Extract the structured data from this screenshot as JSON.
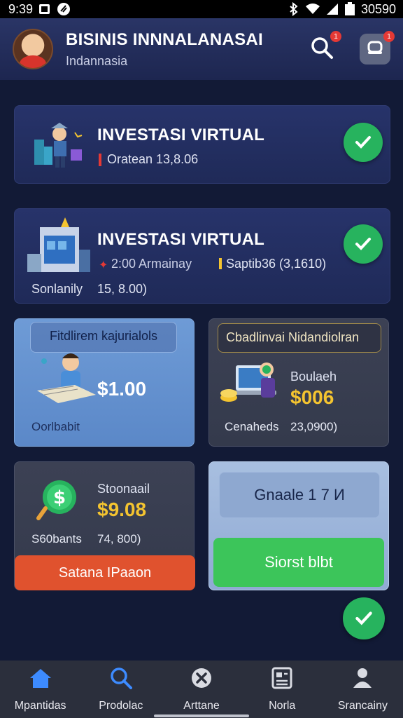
{
  "status_bar": {
    "time": "9:39",
    "battery_text": "30590"
  },
  "header": {
    "title": "BISINIS INNNALANASAI",
    "subtitle": "Indannasia",
    "search_badge": "1",
    "notif_badge": "1"
  },
  "card1": {
    "title": "INVESTASI VIRTUAL",
    "sub": "Oratean 13,8.06"
  },
  "card2": {
    "title": "INVESTASI VIRTUAL",
    "left_stat": "2:00 Armainay",
    "right_stat": "Saptib36 (3,1610)",
    "bottom_label": "Sonlanily",
    "bottom_value": "15, 8.00)"
  },
  "card3": {
    "title": "Fitdlirem kajurialols",
    "amount": "$1.00",
    "caption": "Oorlbabit"
  },
  "card4": {
    "title": "Cbadlinvai Nidandiolran",
    "label": "Boulaeh",
    "amount": "$006",
    "caption_label": "Cenaheds",
    "caption_value": "23,0900)"
  },
  "card5": {
    "label": "Stoonaail",
    "amount": "$9.08",
    "caption_label": "S60bants",
    "caption_value": "74, 800)",
    "button": "Satana IPaaon"
  },
  "card6": {
    "field": "Gnaale 1 7 И",
    "button": "Siorst blbt"
  },
  "nav": [
    {
      "label": "Mpantidas"
    },
    {
      "label": "Prodolac"
    },
    {
      "label": "Arttane"
    },
    {
      "label": "Norla"
    },
    {
      "label": "Srancainy"
    }
  ],
  "colors": {
    "accent_green": "#27b35e",
    "accent_orange": "#e0522e",
    "gold": "#f4c430",
    "nav_active": "#3d8bff"
  }
}
